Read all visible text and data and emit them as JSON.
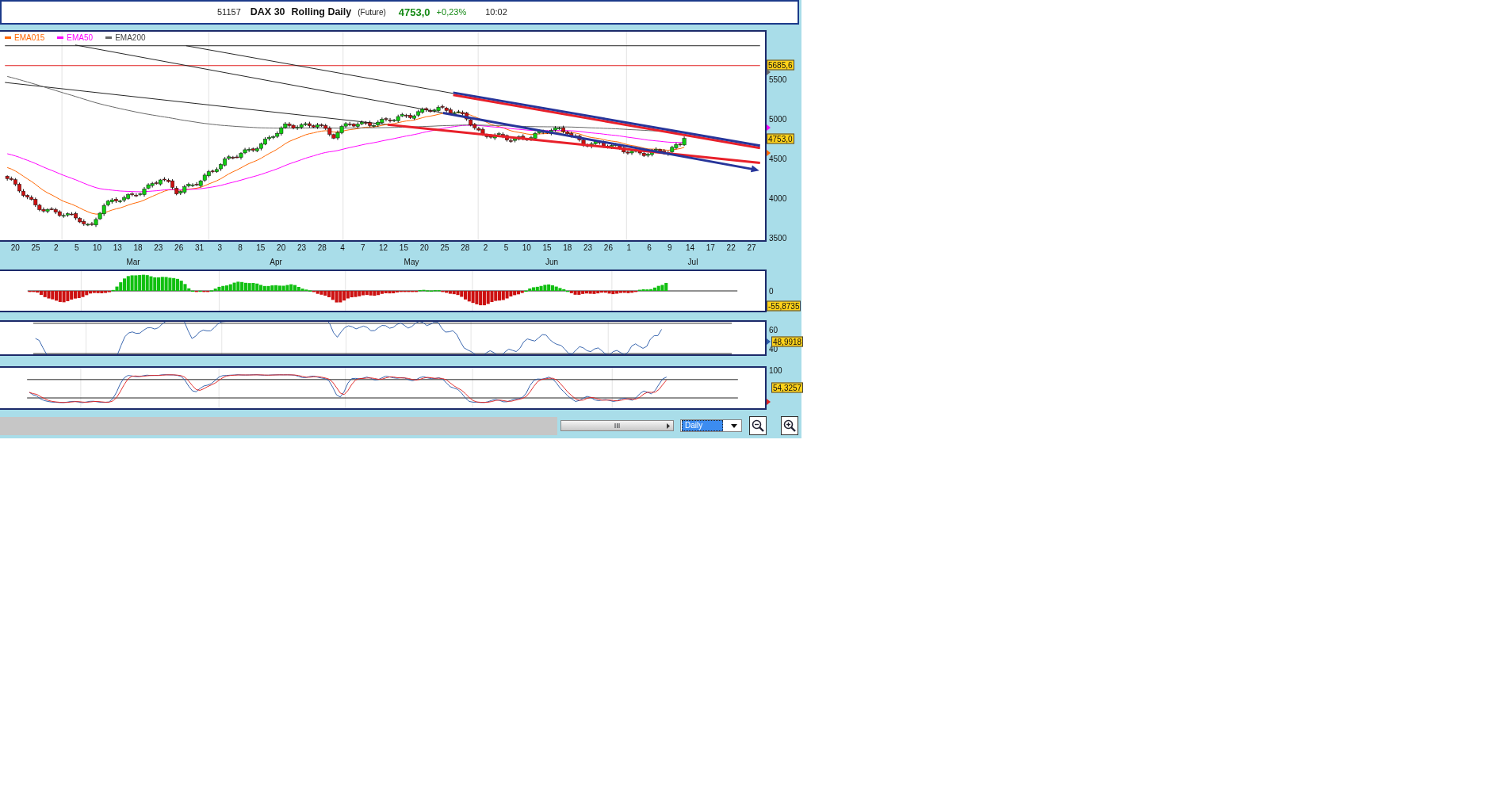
{
  "header": {
    "code": "51157",
    "instrument": "DAX 30",
    "title": "Rolling Daily",
    "contract": "(Future)",
    "last": "4753,0",
    "change": "+0,23%",
    "time": "10:02"
  },
  "price_panel": {
    "legend": [
      {
        "label": "EMA015",
        "color": "#ff6600"
      },
      {
        "label": "EMA50",
        "color": "#ff00ff"
      },
      {
        "label": "EMA200",
        "color": "#666666"
      }
    ],
    "y_axis": [
      "5500",
      "5000",
      "4500",
      "4000",
      "3500"
    ],
    "level_labels": [
      "5685,6",
      "4753,0"
    ]
  },
  "date_axis": {
    "days": [
      "20",
      "25",
      "2",
      "5",
      "10",
      "13",
      "18",
      "23",
      "26",
      "31",
      "3",
      "8",
      "15",
      "20",
      "23",
      "28",
      "4",
      "7",
      "12",
      "15",
      "20",
      "25",
      "28",
      "2",
      "5",
      "10",
      "15",
      "18",
      "23",
      "26",
      "1",
      "6",
      "9",
      "14",
      "17",
      "22",
      "27"
    ],
    "months": [
      "Mar",
      "Apr",
      "May",
      "Jun",
      "Jul"
    ]
  },
  "macd_panel": {
    "y_axis": [
      "0"
    ],
    "reading": "-55,8735"
  },
  "rsi_panel": {
    "y_axis": [
      "60",
      "40"
    ],
    "reading": "48,9918"
  },
  "stoch_panel": {
    "y_axis": [
      "100"
    ],
    "reading": "54,3257"
  },
  "toolbar": {
    "scroll_grip": "III",
    "period": "Daily"
  }
}
